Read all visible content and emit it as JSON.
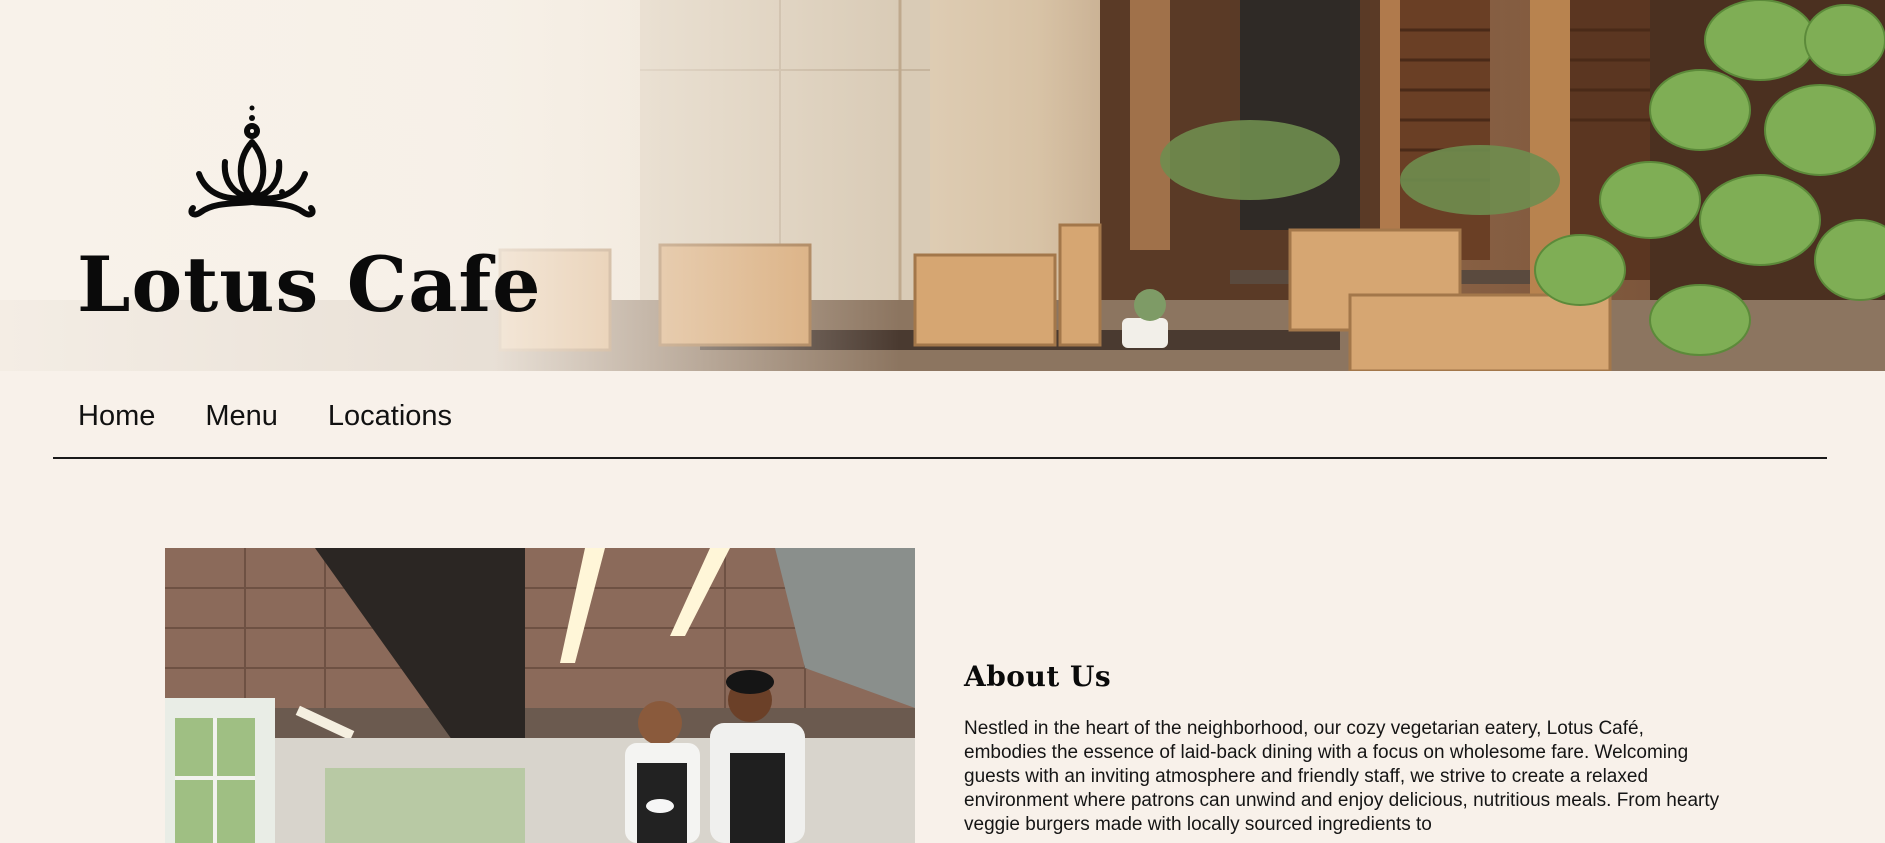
{
  "brand": {
    "name": "Lotus Cafe",
    "logo_icon": "lotus-icon"
  },
  "nav": {
    "items": [
      {
        "label": "Home"
      },
      {
        "label": "Menu"
      },
      {
        "label": "Locations"
      }
    ]
  },
  "about": {
    "heading": "About Us",
    "body": "Nestled in the heart of the neighborhood, our cozy vegetarian eatery, Lotus Café, embodies the essence of laid-back dining with a focus on wholesome fare. Welcoming guests with an inviting atmosphere and friendly staff, we strive to create a relaxed environment where patrons can unwind and enjoy delicious, nutritious meals. From hearty veggie burgers made with locally sourced ingredients to"
  },
  "colors": {
    "background": "#f8f1ea",
    "text": "#111111",
    "divider": "#1a1a1a"
  }
}
